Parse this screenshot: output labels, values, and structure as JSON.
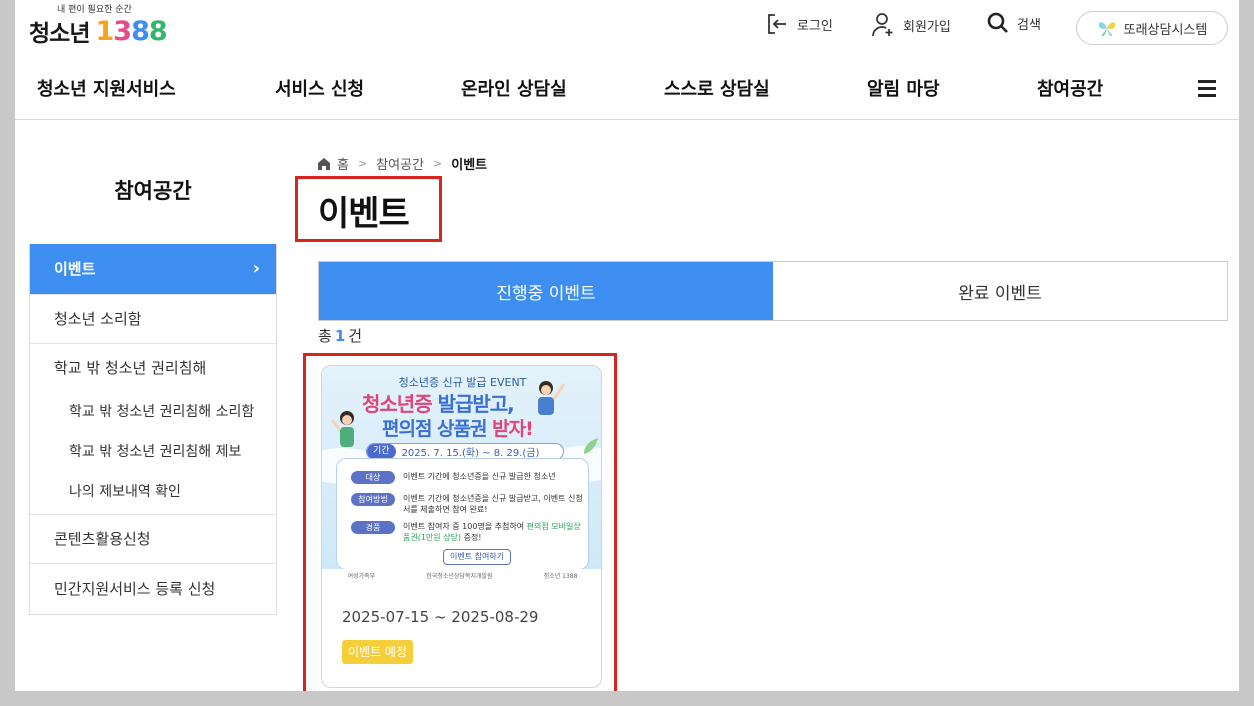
{
  "header": {
    "slogan": "내 편이 필요한 순간",
    "logo_text": "청소년",
    "logo_number": [
      "1",
      "3",
      "8",
      "8"
    ],
    "logo_number_colors": [
      "#f7a21b",
      "#e84b8a",
      "#3d8ef0",
      "#35b56c"
    ],
    "login": "로그인",
    "signup": "회원가입",
    "search": "검색",
    "system": "또래상담시스템"
  },
  "gnb": {
    "items": [
      "청소년 지원서비스",
      "서비스 신청",
      "온라인 상담실",
      "스스로 상담실",
      "알림 마당",
      "참여공간"
    ]
  },
  "sidebar": {
    "title": "참여공간",
    "items": [
      {
        "label": "이벤트",
        "active": true
      },
      {
        "label": "청소년 소리함"
      },
      {
        "label": "학교 밖 청소년 권리침해"
      },
      {
        "label": "학교 밖 청소년 권리침해 소리함",
        "sub": true
      },
      {
        "label": "학교 밖 청소년 권리침해 제보",
        "sub": true
      },
      {
        "label": "나의 제보내역 확인",
        "sub": true
      },
      {
        "label": "콘텐츠활용신청"
      },
      {
        "label": "민간지원서비스 등록 신청"
      }
    ]
  },
  "breadcrumb": {
    "home": "홈",
    "parent": "참여공간",
    "current": "이벤트"
  },
  "page_title": "이벤트",
  "tabs": {
    "ongoing": "진행중 이벤트",
    "finished": "완료 이벤트"
  },
  "total": {
    "prefix": "총",
    "count": "1",
    "suffix": "건"
  },
  "event_card": {
    "date_range": "2025-07-15 ~ 2025-08-29",
    "status": "이벤트 예정",
    "poster": {
      "subtitle": "청소년증 신규 발급 EVENT",
      "headline1_a": "청소년증",
      "headline1_b": " 발급받고,",
      "headline2_a": "편의점 상품권 ",
      "headline2_b": "받자!",
      "period_label": "기간",
      "period": "2025. 7. 15.(화) ~ 8. 29.(금)",
      "target_label": "대상",
      "target": "이벤트 기간에 청소년증을 신규 발급한 청소년",
      "method_label": "참여방법",
      "method": "이벤트 기간에 청소년증을 신규 발급받고, 이벤트 신청서를 제출하면 참여 완료!",
      "prize_label": "경품",
      "prize_a": "이벤트 참여자 중 100명을 추첨하여 ",
      "prize_b": "편의점 모바일상품권(1만원 상당)",
      "prize_c": " 증정!",
      "button": "이벤트 참여하기",
      "footer": [
        "여성가족부",
        "한국청소년상담복지개발원",
        "청소년 1388"
      ]
    }
  },
  "colors": {
    "primary": "#3d8ef0",
    "badge": "#f5cf3a",
    "highlight_border": "#d9231d"
  }
}
